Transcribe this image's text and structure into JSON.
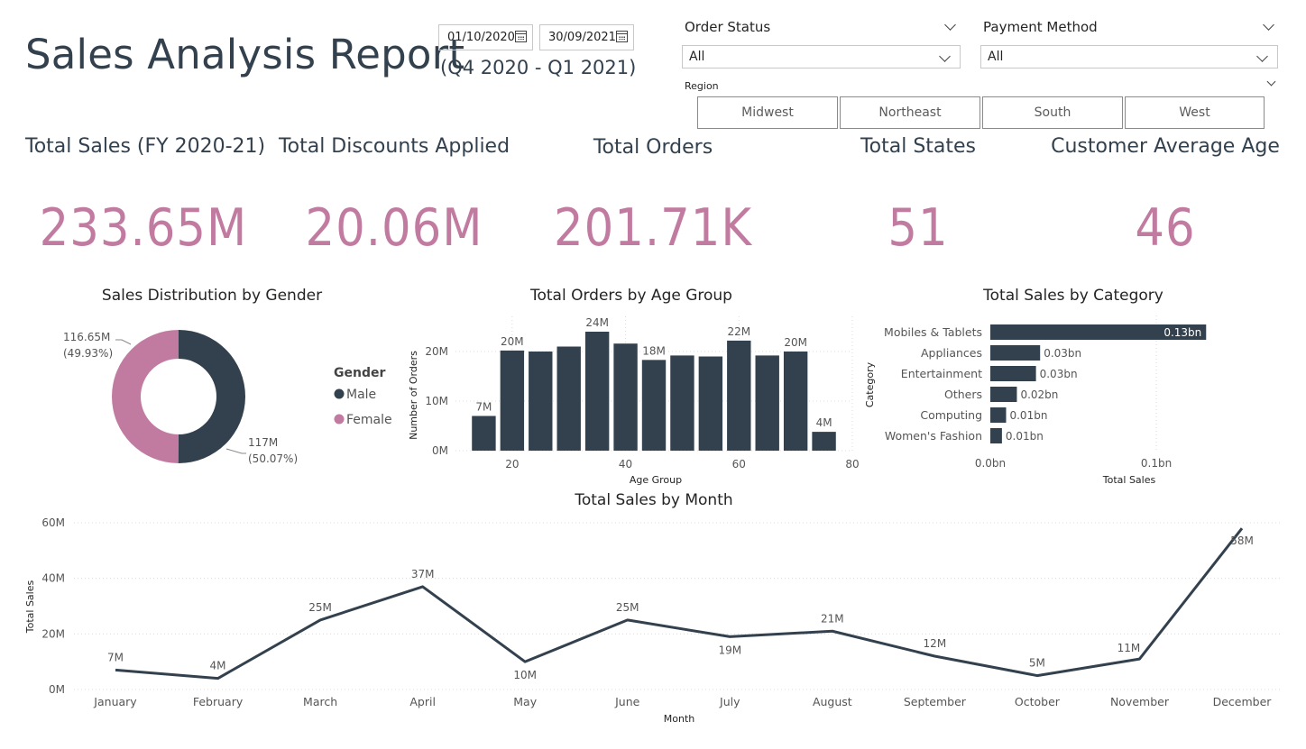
{
  "header": {
    "title": "Sales Analysis Report",
    "subtitle": "(Q4 2020 - Q1 2021)",
    "date_start": "01/10/2020",
    "date_end": "30/09/2021"
  },
  "slicers": {
    "order_status": {
      "title": "Order Status",
      "value": "All"
    },
    "payment_method": {
      "title": "Payment Method",
      "value": "All"
    },
    "region": {
      "title": "Region",
      "options": [
        "Midwest",
        "Northeast",
        "South",
        "West"
      ]
    }
  },
  "kpis": [
    {
      "label": "Total Sales (FY 2020-21)",
      "value": "233.65M"
    },
    {
      "label": "Total Discounts Applied",
      "value": "20.06M"
    },
    {
      "label": "Total Orders",
      "value": "201.71K"
    },
    {
      "label": "Total States",
      "value": "51"
    },
    {
      "label": "Customer Average Age",
      "value": "46"
    }
  ],
  "colors": {
    "accent": "#c27ba0",
    "dark": "#33414e"
  },
  "chart_data": [
    {
      "type": "pie",
      "title": "Sales Distribution by Gender",
      "legend_title": "Gender",
      "legend_position": "right",
      "slices": [
        {
          "name": "Male",
          "value": 117,
          "label": "117M",
          "percent_label": "(50.07%)",
          "color": "#33414e"
        },
        {
          "name": "Female",
          "value": 116.65,
          "label": "116.65M",
          "percent_label": "(49.93%)",
          "color": "#c27ba0"
        }
      ]
    },
    {
      "type": "bar",
      "title": "Total Orders by Age Group",
      "xlabel": "Age Group",
      "ylabel": "Number of Orders",
      "x": [
        15,
        20,
        25,
        30,
        35,
        40,
        45,
        50,
        55,
        60,
        65,
        70,
        75
      ],
      "values": [
        7,
        20.2,
        20,
        21,
        24,
        21.6,
        18.3,
        19.2,
        19,
        22.2,
        19.2,
        20,
        3.8
      ],
      "data_labels": [
        "7M",
        "20M",
        "",
        "",
        "24M",
        "",
        "18M",
        "",
        "",
        "22M",
        "",
        "20M",
        "4M"
      ],
      "xticks": [
        "20",
        "40",
        "60",
        "80"
      ],
      "yticks": [
        "0M",
        "10M",
        "20M"
      ],
      "xlim": [
        10,
        80
      ],
      "ylim": [
        0,
        26
      ]
    },
    {
      "type": "bar",
      "orientation": "horizontal",
      "title": "Total Sales by Category",
      "xlabel": "Total Sales",
      "ylabel": "Category",
      "categories": [
        "Mobiles & Tablets",
        "Appliances",
        "Entertainment",
        "Others",
        "Computing",
        "Women's Fashion"
      ],
      "values": [
        0.13,
        0.03,
        0.0275,
        0.016,
        0.0095,
        0.007
      ],
      "data_labels": [
        "0.13bn",
        "0.03bn",
        "0.03bn",
        "0.02bn",
        "0.01bn",
        "0.01bn"
      ],
      "xticks": [
        "0.0bn",
        "0.1bn"
      ],
      "xlim": [
        0,
        0.1505
      ]
    },
    {
      "type": "line",
      "title": "Total Sales by Month",
      "xlabel": "Month",
      "ylabel": "Total Sales",
      "categories": [
        "January",
        "February",
        "March",
        "April",
        "May",
        "June",
        "July",
        "August",
        "September",
        "October",
        "November",
        "December"
      ],
      "values": [
        7,
        4,
        25,
        37,
        10,
        25,
        19,
        21,
        12,
        5,
        11,
        58
      ],
      "data_labels": [
        "7M",
        "4M",
        "25M",
        "37M",
        "10M",
        "25M",
        "19M",
        "21M",
        "12M",
        "5M",
        "11M",
        "58M"
      ],
      "yticks": [
        "0M",
        "20M",
        "40M",
        "60M"
      ],
      "ylim": [
        0,
        60
      ]
    }
  ]
}
